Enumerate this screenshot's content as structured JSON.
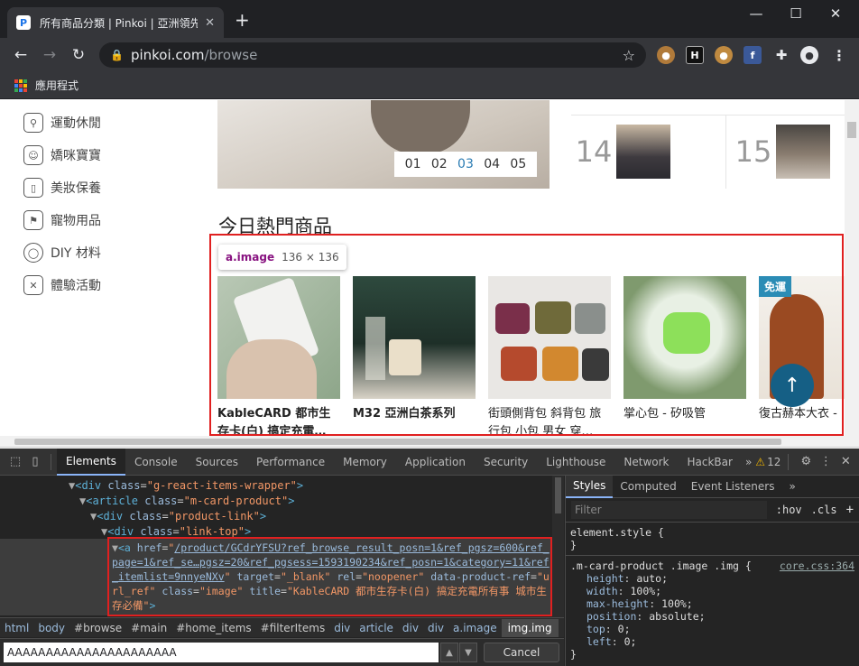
{
  "browser": {
    "tab_title": "所有商品分類 | Pinkoi | 亞洲領先",
    "tab_favicon": "P",
    "tab_close": "✕",
    "new_tab": "+",
    "url_host": "pinkoi.com",
    "url_path": "/browse",
    "bookmarks_label": "應用程式",
    "extension_icons": [
      "cookie-icon",
      "hackbar-icon",
      "cookie-icon",
      "facebook-icon",
      "puzzle-icon"
    ]
  },
  "sidebar": {
    "items": [
      {
        "label": "運動休閒",
        "icon": "bicycle-icon"
      },
      {
        "label": "嬌咪寶寶",
        "icon": "baby-icon"
      },
      {
        "label": "美妝保養",
        "icon": "bottle-icon"
      },
      {
        "label": "寵物用品",
        "icon": "pet-icon"
      },
      {
        "label": "DIY 材料",
        "icon": "lightbulb-icon"
      },
      {
        "label": "體驗活動",
        "icon": "tools-icon"
      }
    ]
  },
  "carousel": {
    "pages": [
      "01",
      "02",
      "03",
      "04",
      "05"
    ],
    "active_index": 2
  },
  "ranking": {
    "items": [
      {
        "num": "14"
      },
      {
        "num": "15"
      }
    ]
  },
  "section": {
    "title": "今日熱門商品"
  },
  "inspect_tooltip": {
    "element": "a.image",
    "size": "136 × 136"
  },
  "products": [
    {
      "name": "KableCARD 都市生存卡(白) 搞定充電…",
      "badge": ""
    },
    {
      "name": "M32 亞洲白茶系列",
      "badge": ""
    },
    {
      "name": "街頭側背包 斜背包 旅行包 小包 男女 穿…",
      "badge": ""
    },
    {
      "name": "掌心包 - 矽吸管",
      "badge": ""
    },
    {
      "name": "復古赫本大衣 -",
      "badge": "免運"
    }
  ],
  "devtools": {
    "tabs": [
      "Elements",
      "Console",
      "Sources",
      "Performance",
      "Memory",
      "Application",
      "Security",
      "Lighthouse",
      "Network",
      "HackBar"
    ],
    "active_tab": "Elements",
    "warnings": "12",
    "code_lines": [
      {
        "indent": 0,
        "tag": "div",
        "cls": "g-react-items-wrapper"
      },
      {
        "indent": 1,
        "tag": "article",
        "cls": "m-card-product"
      },
      {
        "indent": 2,
        "tag": "div",
        "cls": "product-link"
      },
      {
        "indent": 3,
        "tag": "div",
        "cls": "link-top"
      }
    ],
    "selected_element": {
      "href": "/product/GCdrYFSU?ref_browse_result_posn=1&ref_pgsz=600&ref_page=1&ref_se…pgsz=20&ref_pgsess=1593190234&ref_posn=1&category=11&ref_itemlist=9nnyeNXv",
      "target": "_blank",
      "rel": "noopener",
      "data_product_ref": "url_ref",
      "cls": "image",
      "title": "KableCARD 都市生存卡(白) 搞定充電所有事 城市生存必備"
    },
    "breadcrumbs": [
      "html",
      "body",
      "#browse",
      "#main",
      "#home_items",
      "#filterItems",
      "div",
      "article",
      "div",
      "div",
      "a.image",
      "img.img"
    ],
    "search_value": "AAAAAAAAAAAAAAAAAAAAAA",
    "cancel_label": "Cancel",
    "styles_tabs": [
      "Styles",
      "Computed",
      "Event Listeners"
    ],
    "filter_placeholder": "Filter",
    "filter_hov": ":hov",
    "filter_cls": ".cls",
    "element_style": "element.style {",
    "rule_selector": ".m-card-product .image .img {",
    "rule_source": "core.css:364",
    "rule_props": [
      {
        "name": "height",
        "value": "auto;"
      },
      {
        "name": "width",
        "value": "100%;"
      },
      {
        "name": "max-height",
        "value": "100%;"
      },
      {
        "name": "position",
        "value": "absolute;"
      },
      {
        "name": "top",
        "value": "0;"
      },
      {
        "name": "left",
        "value": "0;"
      }
    ]
  }
}
